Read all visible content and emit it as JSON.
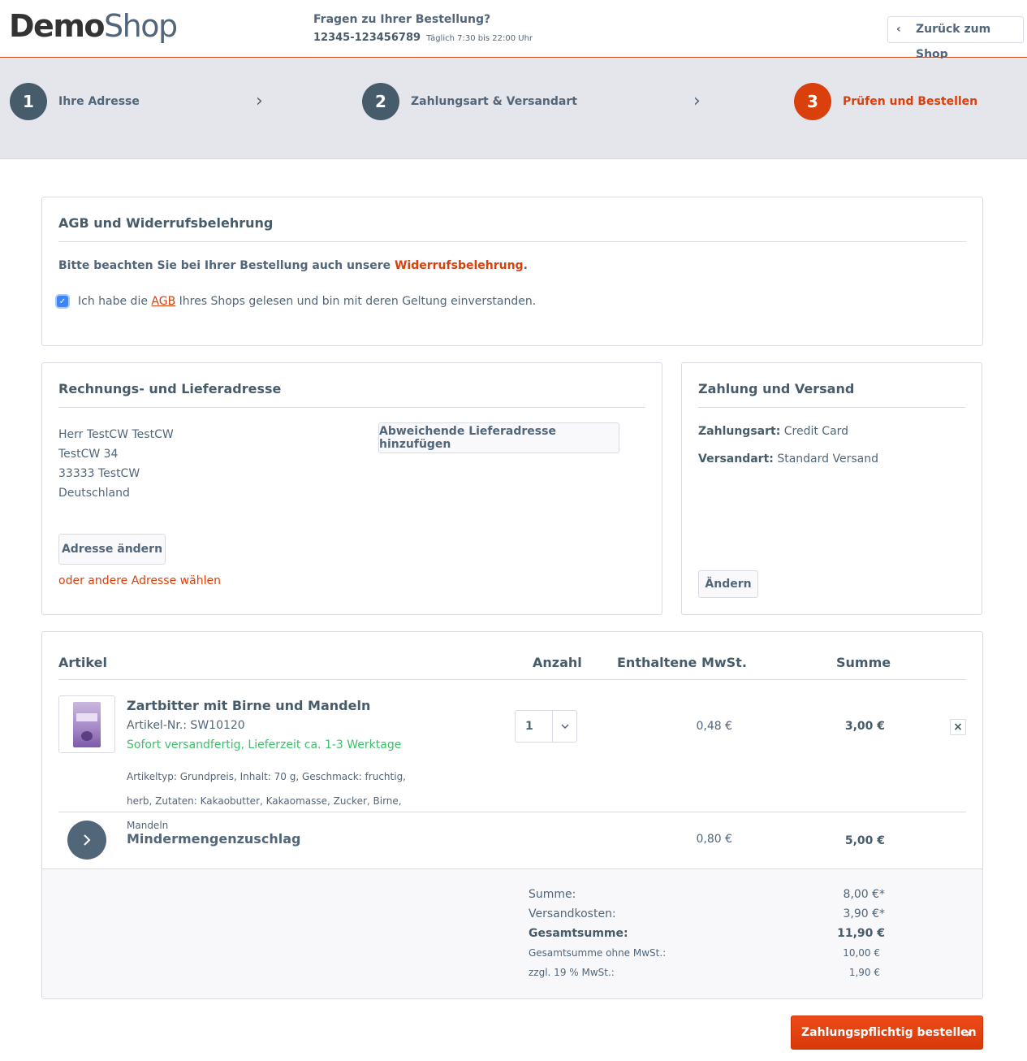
{
  "header": {
    "logo_part1": "Demo",
    "logo_part2": "Shop",
    "support_question": "Fragen zu Ihrer Bestellung?",
    "support_phone": "12345-123456789",
    "support_hours": "Täglich 7:30 bis 22:00 Uhr",
    "back_label": "Zurück zum Shop"
  },
  "steps": [
    {
      "num": "1",
      "label": "Ihre Adresse"
    },
    {
      "num": "2",
      "label": "Zahlungsart & Versandart"
    },
    {
      "num": "3",
      "label": "Prüfen und Bestellen"
    }
  ],
  "agb": {
    "title": "AGB und Widerrufsbelehrung",
    "note_prefix": "Bitte beachten Sie bei Ihrer Bestellung auch unsere",
    "note_link": "Widerrufsbelehrung",
    "note_suffix": ".",
    "check_prefix": "Ich habe die",
    "check_link": "AGB",
    "check_suffix": "Ihres Shops gelesen und bin mit deren Geltung einverstanden.",
    "checked": true
  },
  "address": {
    "title": "Rechnungs- und Lieferadresse",
    "lines": [
      "Herr TestCW TestCW",
      "TestCW 34",
      "33333 TestCW",
      "Deutschland"
    ],
    "add_delivery_label": "Abweichende Lieferadresse hinzufügen",
    "change_label": "Adresse ändern",
    "other_link": "oder andere Adresse wählen"
  },
  "payment": {
    "title": "Zahlung und Versand",
    "pay_label": "Zahlungsart:",
    "pay_value": "Credit Card",
    "ship_label": "Versandart:",
    "ship_value": "Standard Versand",
    "change_label": "Ändern"
  },
  "cart": {
    "col_article": "Artikel",
    "col_qty": "Anzahl",
    "col_vat": "Enthaltene MwSt.",
    "col_sum": "Summe",
    "item": {
      "name": "Zartbitter mit Birne und Mandeln",
      "number": "Artikel-Nr.: SW10120",
      "stock": "Sofort versandfertig, Lieferzeit ca. 1-3 Werktage",
      "desc_line1": "Artikeltyp: Grundpreis, Inhalt: 70 g, Geschmack: fruchtig,",
      "desc_line2": "herb, Zutaten: Kakaobutter, Kakaomasse, Zucker, Birne, Mandeln",
      "qty": "1",
      "vat": "0,48 €",
      "sum": "3,00 €",
      "remove_symbol": "×"
    },
    "surcharge": {
      "name": "Mindermengenzuschlag",
      "vat": "0,80 €",
      "sum": "5,00 €"
    },
    "totals": [
      {
        "label": "Summe:",
        "value": "8,00 €*",
        "style": "md"
      },
      {
        "label": "Versandkosten:",
        "value": "3,90 €*",
        "style": "md"
      },
      {
        "label": "Gesamtsumme:",
        "value": "11,90 €",
        "style": "bd"
      },
      {
        "label": "Gesamtsumme ohne MwSt.:",
        "value": "10,00 €",
        "style": "sm"
      },
      {
        "label": "zzgl. 19 % MwSt.:",
        "value": "1,90 €",
        "style": "sm"
      }
    ]
  },
  "order_button": "Zahlungspflichtig bestellen",
  "colors": {
    "accent": "#d9400b",
    "text": "#52667a",
    "dark": "#475c6a",
    "stock_green": "#3cbf6a"
  },
  "icons": [
    "chevron-left-icon",
    "chevron-right-icon",
    "chevron-down-icon",
    "checkbox-checked-icon",
    "close-icon",
    "product-thumbnail"
  ]
}
